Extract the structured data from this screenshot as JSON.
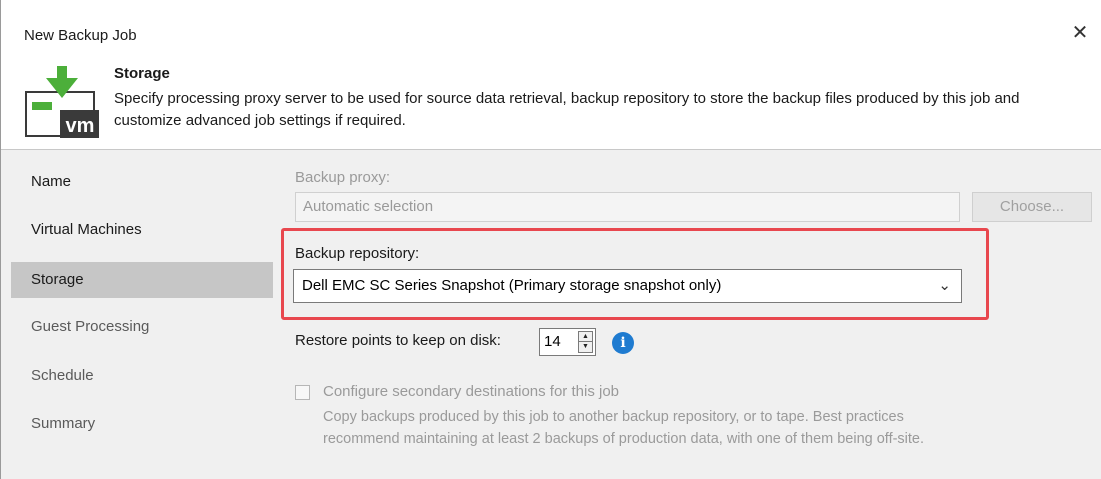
{
  "window": {
    "title": "New Backup Job",
    "close_glyph": "✕"
  },
  "header": {
    "icon": "vm-backup-icon",
    "title": "Storage",
    "description": "Specify processing proxy server to be used for source data retrieval, backup repository to store the backup files produced by this job and customize advanced job settings if required.",
    "logo_text": "vm"
  },
  "sidebar": {
    "items": [
      {
        "label": "Name",
        "state": "normal"
      },
      {
        "label": "Virtual Machines",
        "state": "normal"
      },
      {
        "label": "Storage",
        "state": "active"
      },
      {
        "label": "Guest Processing",
        "state": "disabled"
      },
      {
        "label": "Schedule",
        "state": "disabled"
      },
      {
        "label": "Summary",
        "state": "disabled"
      }
    ]
  },
  "content": {
    "proxy_label": "Backup proxy:",
    "proxy_value": "Automatic selection",
    "choose_button": "Choose...",
    "repo_label": "Backup repository:",
    "repo_value": "Dell EMC SC Series Snapshot (Primary storage snapshot only)",
    "restore_label": "Restore points to keep on disk:",
    "restore_value": "14",
    "secondary_label": "Configure secondary destinations for this job",
    "secondary_desc_1": "Copy backups produced by this job to another backup repository, or to tape. Best practices",
    "secondary_desc_2": "recommend maintaining at least 2 backups of production data, with one of them being off-site.",
    "info_glyph": "i"
  },
  "colors": {
    "highlight": "#e8474e",
    "info": "#1f7bd0",
    "logo_green": "#4caf3a",
    "logo_dark": "#3a3a3a"
  }
}
